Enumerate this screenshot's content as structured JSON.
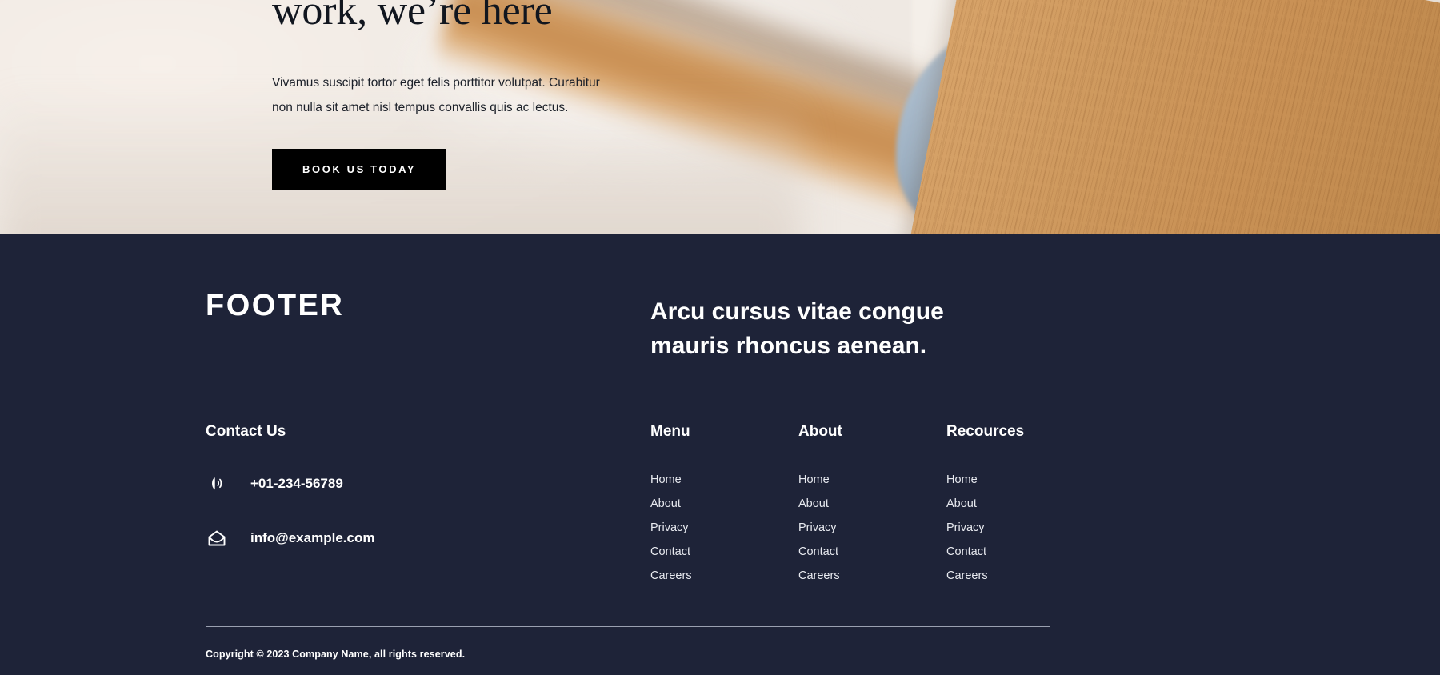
{
  "hero": {
    "title": "work, we’re here",
    "subtitle": "Vivamus suscipit tortor eget felis porttitor volutpat. Curabitur non nulla sit amet nisl tempus convallis quis ac lectus.",
    "cta_label": "BOOK US TODAY",
    "cta_bg": "#000000",
    "cta_text_color": "#ffffff",
    "background_description": "blurred desk with wooden pencil, grey computer mouse and wooden board"
  },
  "footer": {
    "background": "#1e2338",
    "text_color": "#ffffff",
    "brand": "FOOTER",
    "tagline": "Arcu cursus vitae congue mauris rhoncus aenean.",
    "contact": {
      "heading": "Contact Us",
      "items": [
        {
          "icon": "phone-icon",
          "value": "+01-234-56789"
        },
        {
          "icon": "envelope-icon",
          "value": "info@example.com"
        }
      ]
    },
    "link_columns": [
      {
        "heading": "Menu",
        "links": [
          "Home",
          "About",
          "Privacy",
          "Contact",
          "Careers"
        ]
      },
      {
        "heading": "About",
        "links": [
          "Home",
          "About",
          "Privacy",
          "Contact",
          "Careers"
        ]
      },
      {
        "heading": "Recources",
        "links": [
          "Home",
          "About",
          "Privacy",
          "Contact",
          "Careers"
        ]
      }
    ],
    "copyright": "Copyright © 2023 Company Name, all rights reserved."
  }
}
